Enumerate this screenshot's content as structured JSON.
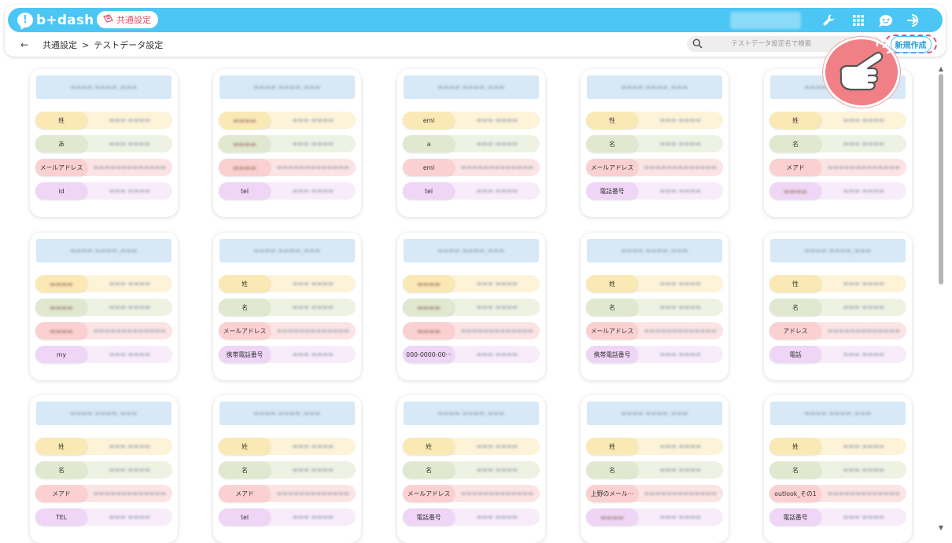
{
  "app": {
    "brand": "b+dash",
    "brand_mark": "!",
    "section_pill": "共通設定"
  },
  "breadcrumb": {
    "back_icon": "←",
    "parent": "共通設定",
    "separator": ">",
    "current": "テストデータ設定"
  },
  "search": {
    "placeholder": "テストデータ設定名で検索"
  },
  "toolbar": {
    "new_button": "新規作成",
    "icons": [
      "wrench-icon",
      "grid-apps-icon",
      "chat-robot-icon",
      "logout-icon"
    ]
  },
  "cards": [
    {
      "rows": [
        {
          "key": "姓",
          "key_blurred": false
        },
        {
          "key": "あ",
          "key_blurred": false
        },
        {
          "key": "メールアドレス",
          "key_blurred": false
        },
        {
          "key": "id",
          "key_blurred": false
        }
      ]
    },
    {
      "rows": [
        {
          "key": "",
          "key_blurred": true
        },
        {
          "key": "",
          "key_blurred": true
        },
        {
          "key": "",
          "key_blurred": true
        },
        {
          "key": "tel",
          "key_blurred": false
        }
      ]
    },
    {
      "rows": [
        {
          "key": "eml",
          "key_blurred": false
        },
        {
          "key": "a",
          "key_blurred": false
        },
        {
          "key": "eml",
          "key_blurred": false
        },
        {
          "key": "tel",
          "key_blurred": false
        }
      ]
    },
    {
      "rows": [
        {
          "key": "性",
          "key_blurred": false
        },
        {
          "key": "名",
          "key_blurred": false
        },
        {
          "key": "メールアドレス",
          "key_blurred": false
        },
        {
          "key": "電話番号",
          "key_blurred": false
        }
      ]
    },
    {
      "rows": [
        {
          "key": "姓",
          "key_blurred": false
        },
        {
          "key": "名",
          "key_blurred": false
        },
        {
          "key": "メアド",
          "key_blurred": false
        },
        {
          "key": "",
          "key_blurred": true
        }
      ]
    },
    {
      "rows": [
        {
          "key": "",
          "key_blurred": true
        },
        {
          "key": "",
          "key_blurred": true
        },
        {
          "key": "",
          "key_blurred": true
        },
        {
          "key": "my",
          "key_blurred": false
        }
      ]
    },
    {
      "rows": [
        {
          "key": "姓",
          "key_blurred": false
        },
        {
          "key": "名",
          "key_blurred": false
        },
        {
          "key": "メールアドレス",
          "key_blurred": false
        },
        {
          "key": "携帯電話番号",
          "key_blurred": false
        }
      ]
    },
    {
      "rows": [
        {
          "key": "",
          "key_blurred": true
        },
        {
          "key": "",
          "key_blurred": true
        },
        {
          "key": "",
          "key_blurred": true
        },
        {
          "key": "000-0000-00···",
          "key_blurred": false
        }
      ]
    },
    {
      "rows": [
        {
          "key": "姓",
          "key_blurred": false
        },
        {
          "key": "名",
          "key_blurred": false
        },
        {
          "key": "メールアドレス",
          "key_blurred": false
        },
        {
          "key": "携帯電話番号",
          "key_blurred": false
        }
      ]
    },
    {
      "rows": [
        {
          "key": "性",
          "key_blurred": false
        },
        {
          "key": "名",
          "key_blurred": false
        },
        {
          "key": "アドレス",
          "key_blurred": false
        },
        {
          "key": "電話",
          "key_blurred": false
        }
      ]
    },
    {
      "rows": [
        {
          "key": "姓",
          "key_blurred": false
        },
        {
          "key": "名",
          "key_blurred": false
        },
        {
          "key": "メアド",
          "key_blurred": false
        },
        {
          "key": "TEL",
          "key_blurred": false
        }
      ]
    },
    {
      "rows": [
        {
          "key": "姓",
          "key_blurred": false
        },
        {
          "key": "名",
          "key_blurred": false
        },
        {
          "key": "メアド",
          "key_blurred": false
        },
        {
          "key": "tel",
          "key_blurred": false
        }
      ]
    },
    {
      "rows": [
        {
          "key": "姓",
          "key_blurred": false
        },
        {
          "key": "名",
          "key_blurred": false
        },
        {
          "key": "メールアドレス",
          "key_blurred": false
        },
        {
          "key": "電話番号",
          "key_blurred": false
        }
      ]
    },
    {
      "rows": [
        {
          "key": "姓",
          "key_blurred": false
        },
        {
          "key": "名",
          "key_blurred": false
        },
        {
          "key": "上野のメール···",
          "key_blurred": false
        },
        {
          "key": "",
          "key_blurred": true
        }
      ]
    },
    {
      "rows": [
        {
          "key": "姓",
          "key_blurred": false
        },
        {
          "key": "名",
          "key_blurred": false
        },
        {
          "key": "outlook_その1",
          "key_blurred": false
        },
        {
          "key": "電話番号",
          "key_blurred": false
        }
      ]
    }
  ],
  "colors": {
    "accent": "#4cc6f4",
    "highlight": "#e8506b"
  }
}
